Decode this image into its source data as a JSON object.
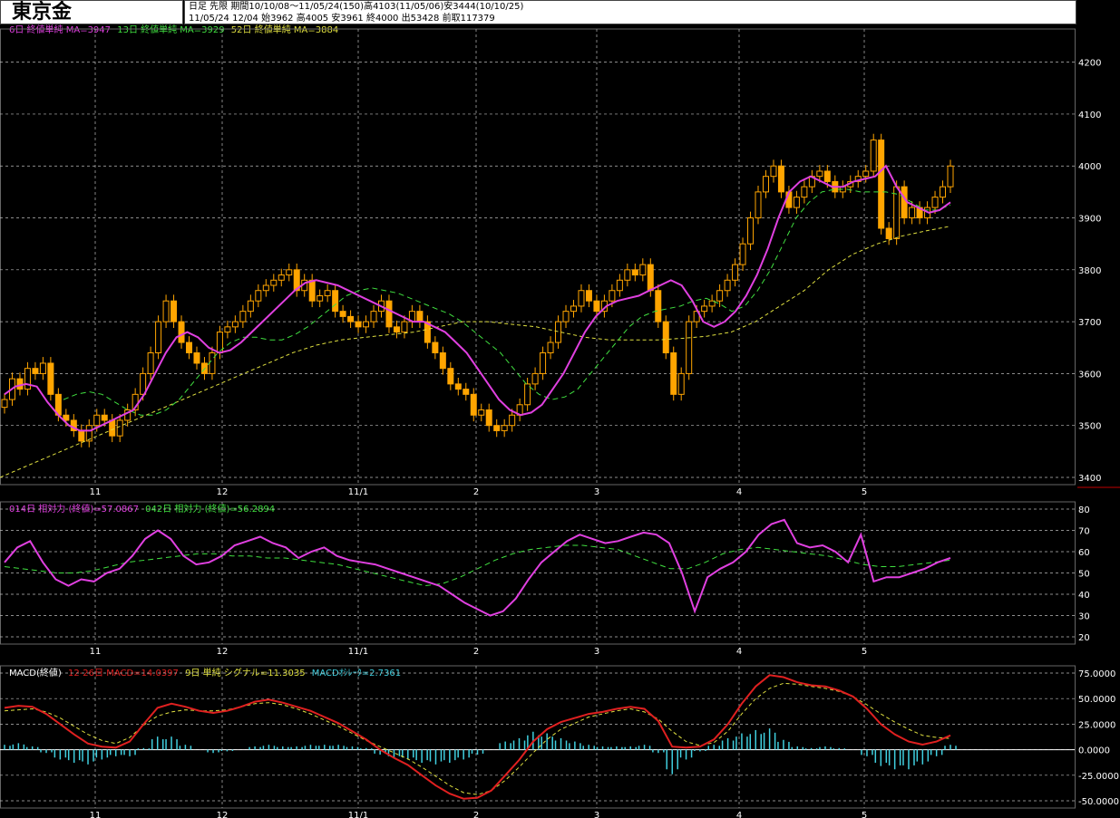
{
  "header": {
    "title": "東京金",
    "info_line1": "日足 先限 期間10/10/08～11/05/24(150)高4103(11/05/06)安3444(10/10/25)",
    "info_line2": "11/05/24 12/04 始3962 高4005 安3961 終4000 出53428 前取117379"
  },
  "legends": {
    "price": [
      {
        "text": "6日 終値単純 MA=3947",
        "color": "#e040e0"
      },
      {
        "text": "13日 終値単純 MA=3929",
        "color": "#40e040"
      },
      {
        "text": "52日 終値単純 MA=3884",
        "color": "#e0e040"
      }
    ],
    "rsi": [
      {
        "text": "014日 相対力 (終値)=57.0867",
        "color": "#e040e0"
      },
      {
        "text": "042日 相対力 (終値)=56.2894",
        "color": "#40e040"
      }
    ],
    "macd": [
      {
        "text": "MACD(終値)",
        "color": "#ffffff"
      },
      {
        "text": "12-26日 MACD=14.0397",
        "color": "#e02020"
      },
      {
        "text": "9日 単純 シグナル=11.3035",
        "color": "#e0e040"
      },
      {
        "text": "MACDｵｼﾚｰﾀ=2.7361",
        "color": "#40d0e0"
      }
    ]
  },
  "colors": {
    "background": "#000000",
    "grid": "#bbbbbb",
    "candle": "#ffa500",
    "ma6": "#e040e0",
    "ma13": "#40e040",
    "ma52": "#e0e040",
    "rsi14": "#e040e0",
    "rsi42": "#40e040",
    "macd": "#e02020",
    "signal": "#e0e040",
    "osc": "#40d0e0"
  },
  "chart_data": [
    {
      "type": "candlestick",
      "title": "東京金",
      "period": "10/10/08～11/05/24",
      "x_tick_labels": [
        "11",
        "12",
        "11/1",
        "2",
        "3",
        "4",
        "5"
      ],
      "ylim": [
        3400,
        4250
      ],
      "y_ticks": [
        3400,
        3500,
        3600,
        3700,
        3800,
        3900,
        4000,
        4100,
        4200
      ],
      "grid": true,
      "close": [
        3550,
        3590,
        3570,
        3610,
        3600,
        3620,
        3560,
        3520,
        3510,
        3490,
        3470,
        3500,
        3520,
        3510,
        3480,
        3510,
        3530,
        3560,
        3600,
        3640,
        3700,
        3740,
        3700,
        3660,
        3640,
        3620,
        3600,
        3640,
        3680,
        3690,
        3700,
        3720,
        3740,
        3760,
        3770,
        3780,
        3790,
        3800,
        3760,
        3780,
        3740,
        3750,
        3760,
        3720,
        3710,
        3700,
        3690,
        3700,
        3720,
        3740,
        3690,
        3680,
        3700,
        3720,
        3700,
        3660,
        3640,
        3610,
        3580,
        3570,
        3560,
        3520,
        3530,
        3500,
        3490,
        3500,
        3520,
        3540,
        3580,
        3600,
        3640,
        3660,
        3700,
        3720,
        3730,
        3760,
        3740,
        3720,
        3740,
        3760,
        3780,
        3800,
        3790,
        3810,
        3760,
        3700,
        3640,
        3560,
        3600,
        3700,
        3720,
        3730,
        3740,
        3760,
        3780,
        3810,
        3850,
        3900,
        3950,
        3980,
        4000,
        3950,
        3920,
        3940,
        3960,
        3980,
        3990,
        3970,
        3950,
        3960,
        3970,
        3980,
        3990,
        4050,
        3880,
        3860,
        3960,
        3900,
        3920,
        3900,
        3920,
        3940,
        3960,
        4000
      ],
      "ma6": [
        3560,
        3575,
        3580,
        3575,
        3545,
        3520,
        3500,
        3490,
        3490,
        3500,
        3510,
        3520,
        3530,
        3560,
        3600,
        3640,
        3670,
        3680,
        3670,
        3650,
        3640,
        3645,
        3660,
        3680,
        3700,
        3720,
        3740,
        3760,
        3775,
        3780,
        3775,
        3770,
        3760,
        3750,
        3740,
        3730,
        3720,
        3710,
        3700,
        3700,
        3690,
        3680,
        3660,
        3640,
        3610,
        3580,
        3550,
        3530,
        3520,
        3525,
        3540,
        3570,
        3600,
        3640,
        3680,
        3710,
        3730,
        3740,
        3745,
        3750,
        3760,
        3770,
        3780,
        3770,
        3740,
        3700,
        3690,
        3700,
        3720,
        3750,
        3790,
        3840,
        3900,
        3950,
        3970,
        3980,
        3970,
        3960,
        3960,
        3970,
        3975,
        3980,
        4000,
        3960,
        3930,
        3920,
        3910,
        3915,
        3930
      ],
      "ma13": [
        3550,
        3560,
        3565,
        3560,
        3545,
        3530,
        3520,
        3520,
        3530,
        3550,
        3580,
        3610,
        3640,
        3660,
        3670,
        3670,
        3665,
        3665,
        3675,
        3690,
        3710,
        3730,
        3750,
        3760,
        3765,
        3760,
        3755,
        3745,
        3735,
        3725,
        3715,
        3700,
        3680,
        3660,
        3640,
        3610,
        3580,
        3560,
        3550,
        3555,
        3570,
        3600,
        3630,
        3660,
        3690,
        3710,
        3720,
        3725,
        3730,
        3740,
        3745,
        3735,
        3720,
        3730,
        3760,
        3800,
        3850,
        3900,
        3930,
        3950,
        3955,
        3955,
        3950,
        3950,
        3950,
        3945,
        3930,
        3915,
        3915,
        3925
      ],
      "ma52": [
        3400,
        3420,
        3440,
        3460,
        3480,
        3500,
        3520,
        3540,
        3560,
        3580,
        3600,
        3620,
        3640,
        3655,
        3665,
        3670,
        3675,
        3680,
        3690,
        3700,
        3700,
        3695,
        3690,
        3680,
        3670,
        3665,
        3665,
        3665,
        3668,
        3672,
        3680,
        3700,
        3730,
        3760,
        3800,
        3830,
        3850,
        3865,
        3875,
        3884
      ],
      "ma6_last": 3947,
      "ma13_last": 3929,
      "ma52_last": 3884
    },
    {
      "type": "line",
      "title": "相対力",
      "ylim": [
        20,
        80
      ],
      "y_ticks": [
        20,
        30,
        40,
        50,
        60,
        70,
        80
      ],
      "x_tick_labels": [
        "11",
        "12",
        "11/1",
        "2",
        "3",
        "4",
        "5"
      ],
      "series": [
        {
          "name": "014日 相対力 (終値)",
          "last": 57.0867,
          "values": [
            55,
            62,
            65,
            55,
            47,
            44,
            47,
            46,
            50,
            52,
            58,
            66,
            70,
            66,
            58,
            54,
            55,
            58,
            63,
            65,
            67,
            64,
            62,
            57,
            60,
            62,
            58,
            56,
            55,
            54,
            52,
            50,
            48,
            46,
            44,
            40,
            36,
            33,
            30,
            32,
            38,
            47,
            55,
            60,
            65,
            68,
            66,
            64,
            65,
            67,
            69,
            68,
            64,
            50,
            32,
            48,
            52,
            55,
            60,
            68,
            73,
            75,
            64,
            62,
            63,
            60,
            55,
            68,
            46,
            48,
            48,
            50,
            52,
            55,
            57
          ]
        },
        {
          "name": "042日 相対力 (終値)",
          "last": 56.2894,
          "values": [
            53,
            52,
            51,
            50,
            50,
            51,
            53,
            55,
            56,
            57,
            58,
            59,
            59,
            58,
            58,
            57,
            57,
            56,
            55,
            54,
            52,
            50,
            48,
            46,
            44,
            45,
            48,
            52,
            56,
            59,
            61,
            62,
            63,
            63,
            62,
            61,
            58,
            55,
            52,
            52,
            55,
            59,
            61,
            62,
            61,
            60,
            59,
            58,
            56,
            54,
            53,
            53,
            54,
            55,
            56
          ]
        }
      ]
    },
    {
      "type": "line",
      "title": "MACD(終値)",
      "ylim": [
        -50,
        75
      ],
      "y_ticks": [
        -50,
        -25,
        0,
        25,
        50,
        75
      ],
      "x_tick_labels": [
        "11",
        "12",
        "11/1",
        "2",
        "3",
        "4",
        "5"
      ],
      "series": [
        {
          "name": "12-26日 MACD",
          "last": 14.0397,
          "values": [
            41,
            43,
            42,
            35,
            25,
            15,
            6,
            3,
            2,
            8,
            25,
            41,
            45,
            42,
            38,
            36,
            38,
            42,
            47,
            49,
            46,
            42,
            38,
            32,
            26,
            18,
            10,
            0,
            -8,
            -15,
            -25,
            -35,
            -43,
            -48,
            -47,
            -40,
            -25,
            -10,
            8,
            20,
            27,
            31,
            35,
            37,
            40,
            42,
            40,
            28,
            3,
            2,
            3,
            10,
            25,
            45,
            62,
            73,
            71,
            66,
            63,
            62,
            58,
            52,
            40,
            25,
            15,
            8,
            5,
            8,
            14
          ]
        },
        {
          "name": "9日 単純 シグナル",
          "last": 11.3035,
          "values": [
            38,
            39,
            40,
            37,
            31,
            23,
            15,
            9,
            6,
            12,
            24,
            33,
            37,
            39,
            38,
            38,
            39,
            42,
            45,
            46,
            44,
            40,
            35,
            29,
            23,
            16,
            9,
            3,
            -3,
            -9,
            -17,
            -26,
            -35,
            -42,
            -44,
            -40,
            -30,
            -17,
            -3,
            10,
            20,
            26,
            32,
            35,
            38,
            40,
            37,
            30,
            18,
            8,
            4,
            7,
            18,
            35,
            50,
            60,
            65,
            64,
            62,
            60,
            57,
            52,
            44,
            35,
            27,
            20,
            14,
            12,
            11
          ]
        },
        {
          "name": "MACDｵｼﾚｰﾀ",
          "last": 2.7361,
          "values": [
            3,
            4,
            2,
            -2,
            -6,
            -8,
            -9,
            -6,
            -4,
            -4,
            1,
            8,
            8,
            3,
            0,
            -2,
            -1,
            0,
            2,
            3,
            2,
            2,
            3,
            3,
            3,
            2,
            1,
            -3,
            -5,
            -6,
            -8,
            -9,
            -8,
            -6,
            -3,
            0,
            5,
            7,
            11,
            10,
            7,
            5,
            3,
            2,
            2,
            2,
            3,
            -2,
            -15,
            -6,
            -1,
            3,
            7,
            10,
            12,
            13,
            6,
            2,
            1,
            2,
            1,
            0,
            -4,
            -10,
            -12,
            -12,
            -9,
            -4,
            3
          ]
        }
      ]
    }
  ]
}
